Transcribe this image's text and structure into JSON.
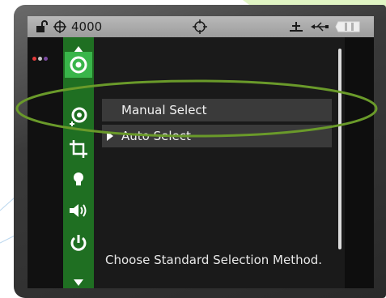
{
  "statusbar": {
    "counter": "4000",
    "icons": [
      "unlock-icon",
      "crosshair-icon",
      "target-icon",
      "satellite-icon",
      "usb-icon",
      "battery-icon"
    ]
  },
  "status_dots": [
    "#e23a3a",
    "#c8c8c8",
    "#7a4aa0"
  ],
  "sidebar": {
    "items": [
      {
        "icon": "target-icon",
        "active": true
      },
      {
        "icon": "target-select-icon",
        "active": false
      },
      {
        "icon": "crop-icon",
        "active": false
      },
      {
        "icon": "bulb-icon",
        "active": false
      },
      {
        "icon": "speaker-icon",
        "active": false
      },
      {
        "icon": "power-icon",
        "active": false
      }
    ]
  },
  "menu": {
    "items": [
      {
        "label": "Manual Select",
        "selected": false
      },
      {
        "label": "Auto Select",
        "selected": true
      }
    ]
  },
  "description": "Choose Standard Selection Method.",
  "colors": {
    "sidebar": "#1f6f22",
    "active": "#39b54a",
    "highlight_ellipse": "#6a9a2a",
    "decoration": "#b7e07a"
  }
}
